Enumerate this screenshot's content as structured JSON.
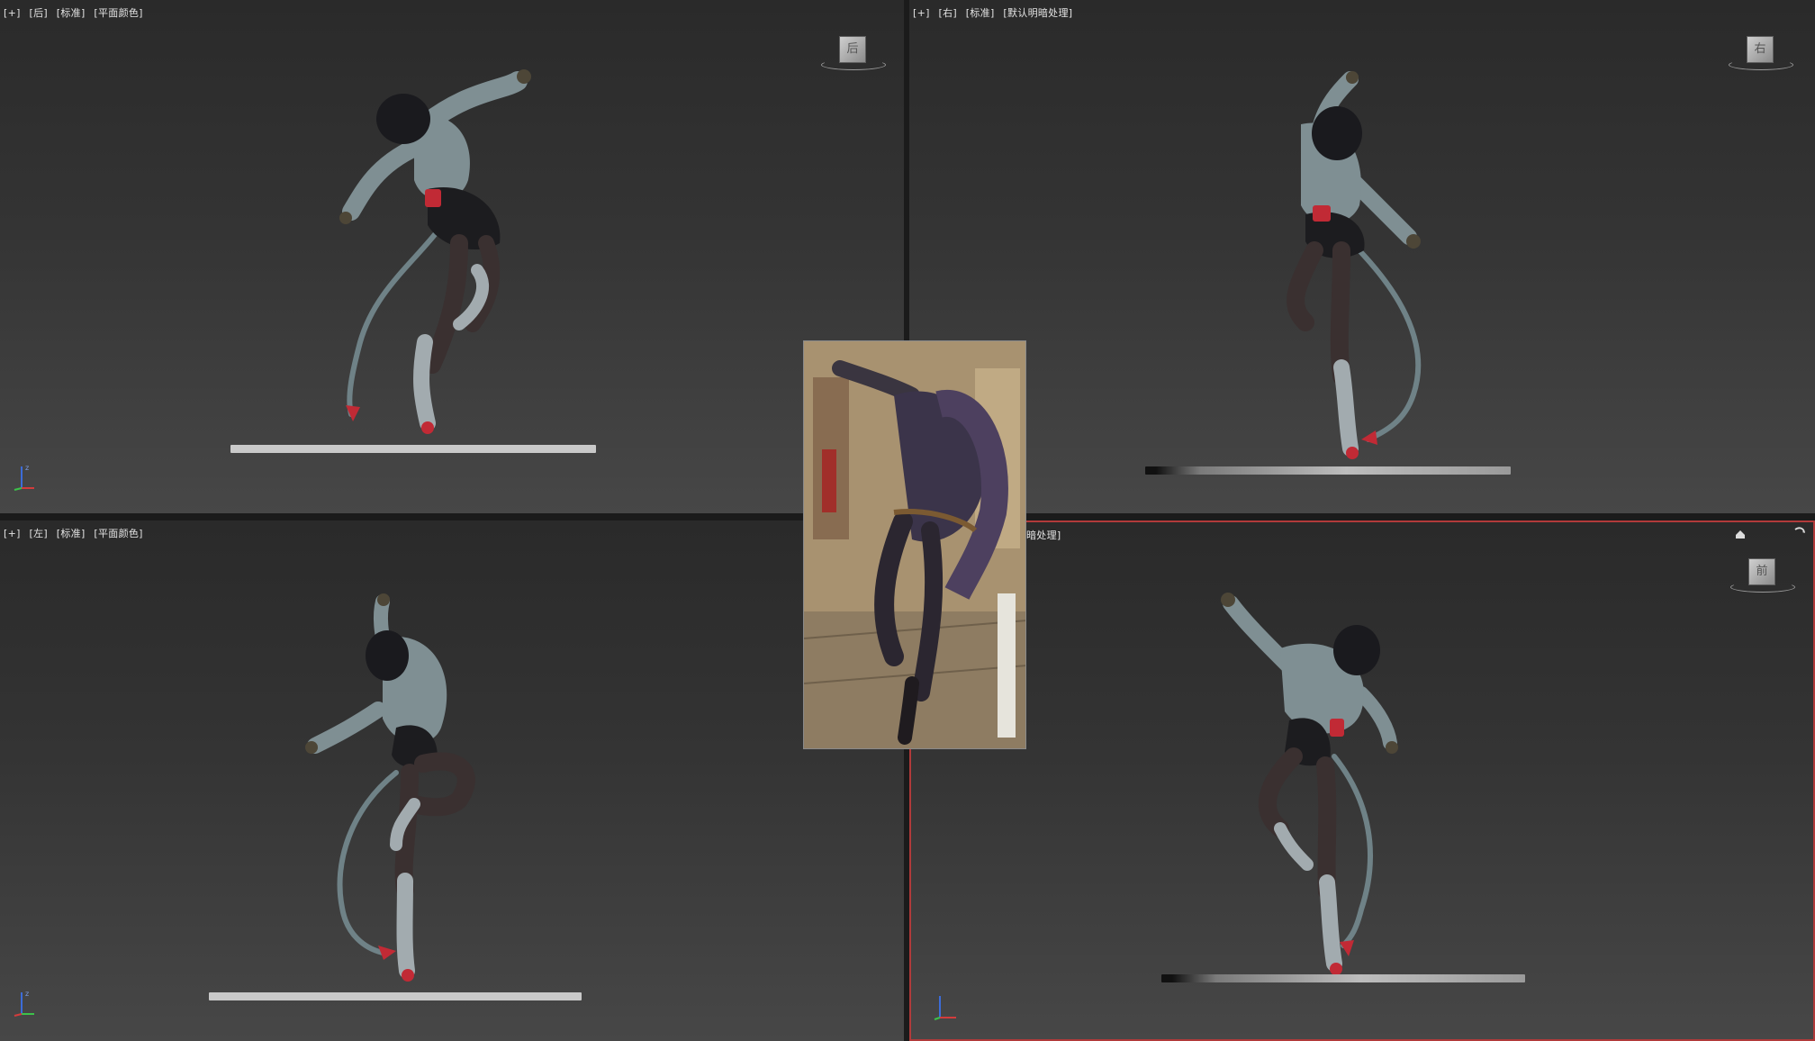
{
  "viewports": {
    "top_left": {
      "tags": [
        "[+]",
        "[后]",
        "[标准]",
        "[平面颜色]"
      ],
      "cube_label": "后"
    },
    "top_right": {
      "tags": [
        "[+]",
        "[右]",
        "[标准]",
        "[默认明暗处理]"
      ],
      "cube_label": "右"
    },
    "bottom_left": {
      "tags": [
        "[+]",
        "[左]",
        "[标准]",
        "[平面颜色]"
      ]
    },
    "bottom_right": {
      "tags": [
        "暗处理]"
      ],
      "cube_label": "前"
    }
  },
  "colors": {
    "active_border": "#b13a3a",
    "viewport_bg_top": "#2a2a2a",
    "viewport_bg_bottom": "#474747",
    "axis_x": "#d23c3c",
    "axis_y": "#3cc24a",
    "axis_z": "#3c6cd8",
    "character_jacket": "#7f8f93",
    "character_hair": "#1a1a1e",
    "character_accent": "#c12a35"
  },
  "icons": {
    "viewcube": "viewcube-icon",
    "axis": "axis-tripod-icon",
    "home": "home-icon",
    "orbit": "orbit-icon",
    "character": "character-model",
    "reference": "reference-image"
  }
}
